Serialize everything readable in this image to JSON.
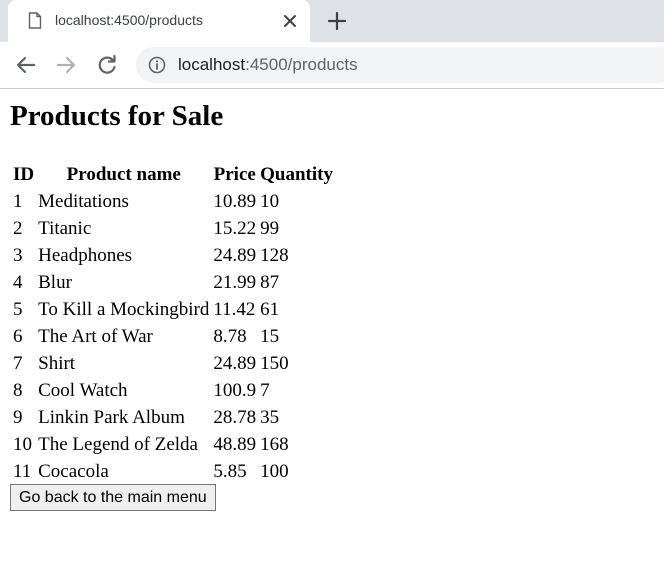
{
  "browser": {
    "tab_title": "localhost:4500/products",
    "url_host": "localhost",
    "url_rest": ":4500/products",
    "icons": {
      "favicon": "page-icon",
      "close": "close-icon",
      "new_tab": "plus-icon",
      "back": "arrow-left-icon",
      "forward": "arrow-right-icon",
      "reload": "reload-icon",
      "site_info": "info-icon"
    }
  },
  "page": {
    "title": "Products for Sale",
    "table": {
      "headers": [
        "ID",
        "Product name",
        "Price",
        "Quantity"
      ],
      "rows": [
        [
          "1",
          "Meditations",
          "10.89",
          "10"
        ],
        [
          "2",
          "Titanic",
          "15.22",
          "99"
        ],
        [
          "3",
          "Headphones",
          "24.89",
          "128"
        ],
        [
          "4",
          "Blur",
          "21.99",
          "87"
        ],
        [
          "5",
          "To Kill a Mockingbird",
          "11.42",
          "61"
        ],
        [
          "6",
          "The Art of War",
          "8.78",
          "15"
        ],
        [
          "7",
          "Shirt",
          "24.89",
          "150"
        ],
        [
          "8",
          "Cool Watch",
          "100.9",
          "7"
        ],
        [
          "9",
          "Linkin Park Album",
          "28.78",
          "35"
        ],
        [
          "10",
          "The Legend of Zelda",
          "48.89",
          "168"
        ],
        [
          "11",
          "Cocacola",
          "5.85",
          "100"
        ]
      ]
    },
    "back_button_label": "Go back to the main menu"
  }
}
